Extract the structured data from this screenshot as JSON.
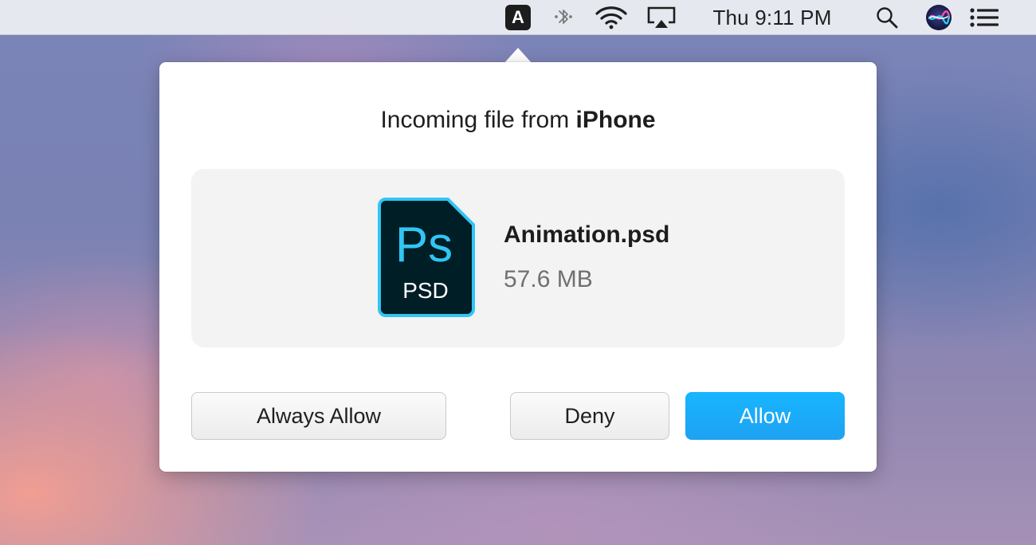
{
  "menubar": {
    "app_icon_letter": "A",
    "clock": "Thu 9:11 PM",
    "icons": [
      "app-icon",
      "bluetooth-icon",
      "wifi-icon",
      "airplay-icon",
      "search-icon",
      "siri-icon",
      "notification-center-icon"
    ]
  },
  "popover": {
    "title_prefix": "Incoming file from",
    "device_name": "iPhone",
    "file": {
      "icon_letters": "Ps",
      "icon_type": "PSD",
      "name": "Animation.psd",
      "size": "57.6 MB"
    },
    "buttons": {
      "always_allow": "Always Allow",
      "deny": "Deny",
      "allow": "Allow"
    }
  },
  "colors": {
    "accent": "#1aacf8",
    "ps_blue": "#31c5f4",
    "ps_bg": "#001e26"
  }
}
